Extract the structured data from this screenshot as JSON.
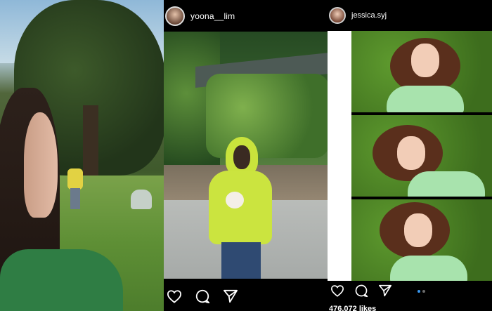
{
  "posts": [
    {
      "username": "yoona__lim",
      "icons": [
        "heart-icon",
        "comment-icon",
        "send-icon"
      ]
    },
    {
      "username": "jessica.syj",
      "icons": [
        "heart-icon",
        "comment-icon",
        "send-icon"
      ],
      "likes": "476,072 likes",
      "carousel_dot_colors": [
        "#3897f0",
        "#6b6b6b"
      ]
    }
  ],
  "colors": {
    "background": "#000000",
    "text": "#ffffff"
  }
}
